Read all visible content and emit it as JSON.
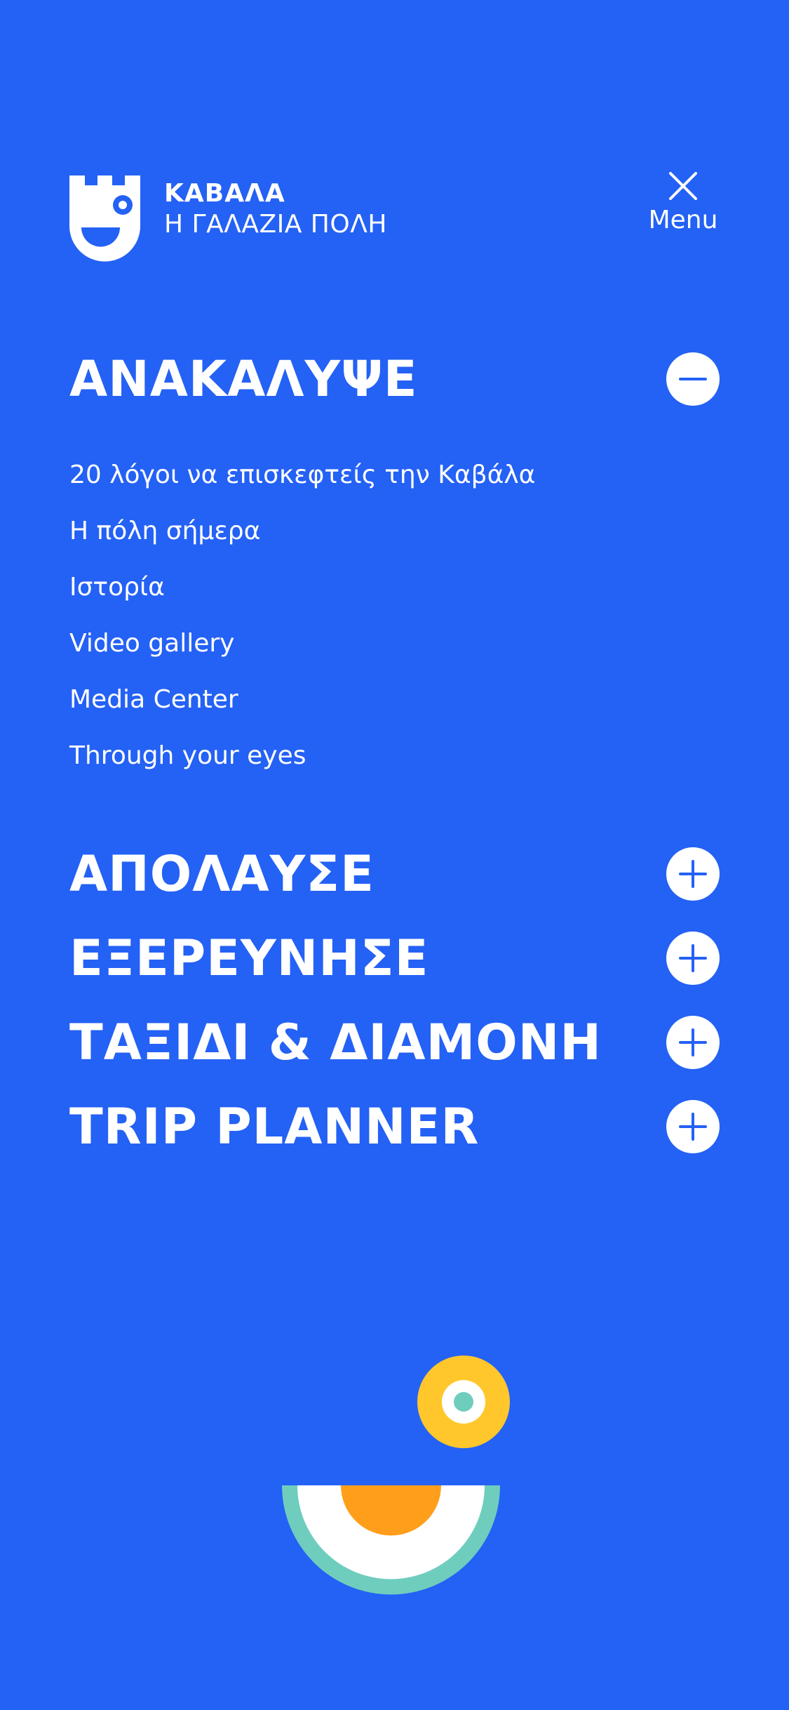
{
  "header": {
    "brand_title": "ΚΑΒΑΛΑ",
    "brand_subtitle": "Η ΓΑΛΑΖΙΑ ΠΟΛΗ",
    "menu_label": "Menu",
    "menu_icon": "close-icon"
  },
  "nav": {
    "sections": [
      {
        "title": "ΑΝΑΚΑΛΥΨΕ",
        "expanded": true,
        "toggle_icon": "minus-icon",
        "items": [
          "20 λόγοι να επισκεφτείς την Καβάλα",
          "Η πόλη σήμερα",
          "Ιστορία",
          "Video gallery",
          "Media Center",
          "Through your eyes"
        ]
      },
      {
        "title": "ΑΠΟΛΑΥΣΕ",
        "expanded": false,
        "toggle_icon": "plus-icon"
      },
      {
        "title": "ΕΞΕΡΕΥΝΗΣΕ",
        "expanded": false,
        "toggle_icon": "plus-icon"
      },
      {
        "title": "ΤΑΞΙΔΙ & ΔΙΑΜΟΝΗ",
        "expanded": false,
        "toggle_icon": "plus-icon"
      },
      {
        "title": "TRIP PLANNER",
        "expanded": false,
        "toggle_icon": "plus-icon"
      }
    ]
  },
  "colors": {
    "background": "#2461F5",
    "foreground": "#FFFFFF",
    "mascot_yellow": "#FFC72C",
    "mascot_orange": "#FF9E1B",
    "mascot_teal": "#6FCDBE"
  }
}
